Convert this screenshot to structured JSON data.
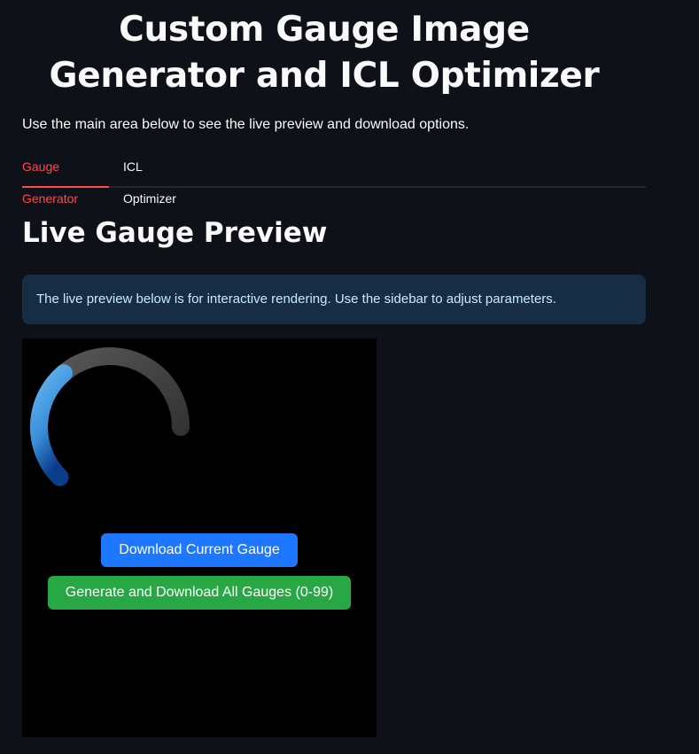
{
  "page": {
    "title": "Custom Gauge Image Generator and ICL Optimizer",
    "subtitle": "Use the main area below to see the live preview and download options."
  },
  "tabs": [
    {
      "label": "Gauge Generator",
      "active": true
    },
    {
      "label": "ICL Optimizer",
      "active": false
    }
  ],
  "section": {
    "heading": "Live Gauge Preview"
  },
  "info": {
    "text": "The live preview below is for interactive rendering. Use the sidebar to adjust parameters."
  },
  "gauge": {
    "value_fraction": 0.42,
    "track_color": "#444444",
    "fill_color_start": "#63b4f0",
    "fill_color_end": "#0b3d8c",
    "background": "#000000"
  },
  "buttons": {
    "download_current": "Download Current Gauge",
    "download_all": "Generate and Download All Gauges (0-99)"
  },
  "colors": {
    "accent": "#ff4b4b",
    "blue_button": "#1e78ff",
    "green_button": "#28a745",
    "info_bg": "#172d43"
  }
}
